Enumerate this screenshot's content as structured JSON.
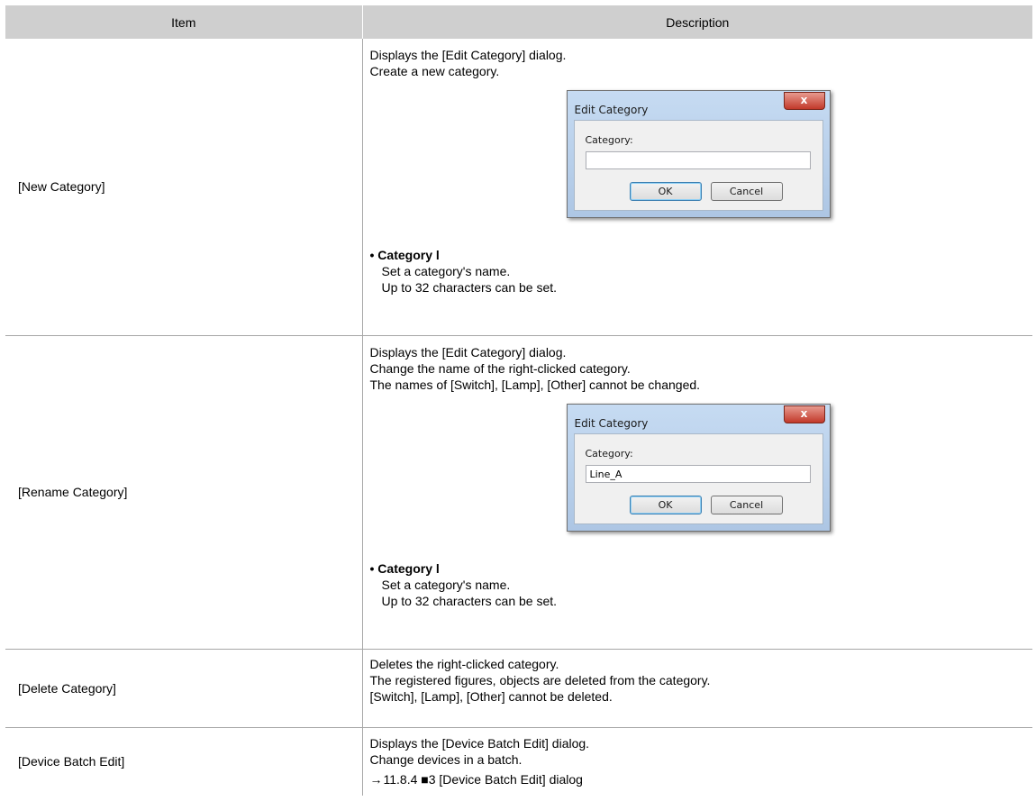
{
  "table": {
    "headers": {
      "item": "Item",
      "description": "Description"
    },
    "rows": [
      {
        "item": "[New Category]",
        "lines": [
          "Displays the [Edit Category] dialog.",
          "Create a new category."
        ],
        "dialog": {
          "title": "Edit Category",
          "close": "x",
          "label": "Category:",
          "value": "",
          "ok": "OK",
          "cancel": "Cancel"
        },
        "bullet_title": "• Category l",
        "bullet_lines": [
          "Set a category's name.",
          "Up to 32 characters can be set."
        ]
      },
      {
        "item": "[Rename Category]",
        "lines": [
          "Displays the [Edit Category] dialog.",
          "Change the name of the right-clicked category.",
          "The names of [Switch], [Lamp], [Other] cannot be changed."
        ],
        "dialog": {
          "title": "Edit Category",
          "close": "x",
          "label": "Category:",
          "value": "Line_A",
          "ok": "OK",
          "cancel": "Cancel"
        },
        "bullet_title": "• Category l",
        "bullet_lines": [
          "Set a category's name.",
          "Up to 32 characters can be set."
        ]
      },
      {
        "item": "[Delete Category]",
        "lines": [
          "Deletes the right-clicked category.",
          "The registered figures, objects are deleted from the category.",
          "[Switch], [Lamp], [Other] cannot be deleted."
        ]
      },
      {
        "item": "[Device Batch Edit]",
        "lines": [
          "Displays the [Device Batch Edit] dialog.",
          "Change devices in a batch."
        ],
        "reference": {
          "arrow": "→",
          "text": "11.8.4 ■3 [Device Batch Edit] dialog"
        }
      }
    ]
  }
}
